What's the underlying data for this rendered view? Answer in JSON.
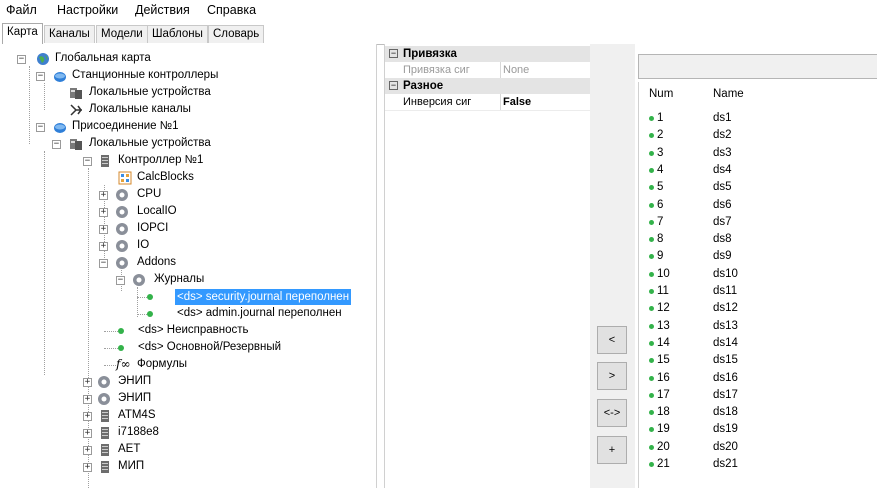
{
  "menu": [
    "Файл",
    "Настройки",
    "Действия",
    "Справка"
  ],
  "tabs": [
    "Карта",
    "Каналы",
    "Модели",
    "Шаблоны",
    "Словарь"
  ],
  "tree": [
    {
      "label": "Глобальная карта",
      "icon": "globe-icon"
    },
    {
      "label": "Станционные контроллеры",
      "icon": "blue-disc-icon"
    },
    {
      "label": "Локальные устройства",
      "icon": "devices-icon"
    },
    {
      "label": "Локальные каналы",
      "icon": "channels-icon"
    },
    {
      "label": "Присоединение №1",
      "icon": "blue-disc-icon"
    },
    {
      "label": "Локальные устройства",
      "icon": "devices-icon"
    },
    {
      "label": "Контроллер №1",
      "icon": "controller-icon"
    },
    {
      "label": "CalcBlocks",
      "icon": "calcblocks-icon"
    },
    {
      "label": "CPU",
      "icon": "gear-icon"
    },
    {
      "label": "LocalIO",
      "icon": "gear-icon"
    },
    {
      "label": "IOPCI",
      "icon": "gear-icon"
    },
    {
      "label": "IO",
      "icon": "gear-icon"
    },
    {
      "label": "Addons",
      "icon": "gear-icon"
    },
    {
      "label": "Журналы",
      "icon": "gear-icon"
    },
    {
      "label": "<ds> security.journal переполнен",
      "icon": "green-dot-icon"
    },
    {
      "label": "<ds> admin.journal переполнен",
      "icon": "green-dot-icon"
    },
    {
      "label": "<ds> Неисправность",
      "icon": "green-dot-icon"
    },
    {
      "label": "<ds> Основной/Резервный",
      "icon": "green-dot-icon"
    },
    {
      "label": "Формулы",
      "icon": "formula-icon"
    },
    {
      "label": "ЭНИП",
      "icon": "gear-icon"
    },
    {
      "label": "ЭНИП",
      "icon": "gear-icon"
    },
    {
      "label": "ATM4S",
      "icon": "controller-icon"
    },
    {
      "label": "i7188e8",
      "icon": "controller-icon"
    },
    {
      "label": "AET",
      "icon": "controller-icon"
    },
    {
      "label": "МИП",
      "icon": "controller-icon"
    }
  ],
  "props": {
    "cat1": "Привязка",
    "row1_key": "Привязка сиг",
    "row1_val": "None",
    "cat2": "Разное",
    "row2_key": "Инверсия сиг",
    "row2_val": "False"
  },
  "buttons": [
    "<",
    ">",
    "<->",
    "+"
  ],
  "list": {
    "col_num": "Num",
    "col_name": "Name",
    "rows": [
      {
        "num": "1",
        "name": "ds1"
      },
      {
        "num": "2",
        "name": "ds2"
      },
      {
        "num": "3",
        "name": "ds3"
      },
      {
        "num": "4",
        "name": "ds4"
      },
      {
        "num": "5",
        "name": "ds5"
      },
      {
        "num": "6",
        "name": "ds6"
      },
      {
        "num": "7",
        "name": "ds7"
      },
      {
        "num": "8",
        "name": "ds8"
      },
      {
        "num": "9",
        "name": "ds9"
      },
      {
        "num": "10",
        "name": "ds10"
      },
      {
        "num": "11",
        "name": "ds11"
      },
      {
        "num": "12",
        "name": "ds12"
      },
      {
        "num": "13",
        "name": "ds13"
      },
      {
        "num": "14",
        "name": "ds14"
      },
      {
        "num": "15",
        "name": "ds15"
      },
      {
        "num": "16",
        "name": "ds16"
      },
      {
        "num": "17",
        "name": "ds17"
      },
      {
        "num": "18",
        "name": "ds18"
      },
      {
        "num": "19",
        "name": "ds19"
      },
      {
        "num": "20",
        "name": "ds20"
      },
      {
        "num": "21",
        "name": "ds21"
      }
    ]
  },
  "colors": {
    "selection": "#3399ff",
    "status_green": "#33b24a",
    "node_blue": "#2f7fd8"
  }
}
